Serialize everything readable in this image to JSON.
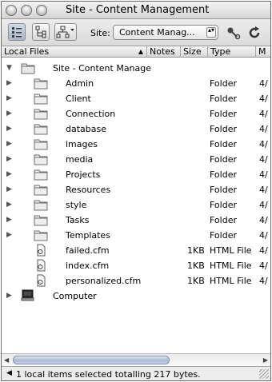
{
  "window": {
    "title": "Site - Content Management"
  },
  "toolbar": {
    "site_label": "Site:",
    "site_value": "Content Manag...",
    "site_arrows": "▴▾"
  },
  "columns": {
    "name": "Local Files",
    "notes": "Notes",
    "size": "Size",
    "type": "Type",
    "modified": "M"
  },
  "root": {
    "name": "Site - Content Manage"
  },
  "folders": [
    {
      "name": "Admin",
      "type": "Folder",
      "modified": "4/"
    },
    {
      "name": "Client",
      "type": "Folder",
      "modified": "4/"
    },
    {
      "name": "Connection",
      "type": "Folder",
      "modified": "4/"
    },
    {
      "name": "database",
      "type": "Folder",
      "modified": "4/"
    },
    {
      "name": "images",
      "type": "Folder",
      "modified": "4/"
    },
    {
      "name": "media",
      "type": "Folder",
      "modified": "4/"
    },
    {
      "name": "Projects",
      "type": "Folder",
      "modified": "4/"
    },
    {
      "name": "Resources",
      "type": "Folder",
      "modified": "4/"
    },
    {
      "name": "style",
      "type": "Folder",
      "modified": "4/"
    },
    {
      "name": "Tasks",
      "type": "Folder",
      "modified": "4/"
    },
    {
      "name": "Templates",
      "type": "Folder",
      "modified": "4/"
    }
  ],
  "files": [
    {
      "name": "failed.cfm",
      "size": "1KB",
      "type": "HTML File",
      "modified": "4/"
    },
    {
      "name": "index.cfm",
      "size": "1KB",
      "type": "HTML File",
      "modified": "4/"
    },
    {
      "name": "personalized.cfm",
      "size": "1KB",
      "type": "HTML File",
      "modified": "4/"
    }
  ],
  "computer": {
    "name": "Computer"
  },
  "status": {
    "text": "1 local items selected totalling 217 bytes."
  },
  "icons": {
    "root": "folder-icon",
    "folder": "folder-icon",
    "file": "cfm-file-icon",
    "computer": "computer-icon"
  }
}
